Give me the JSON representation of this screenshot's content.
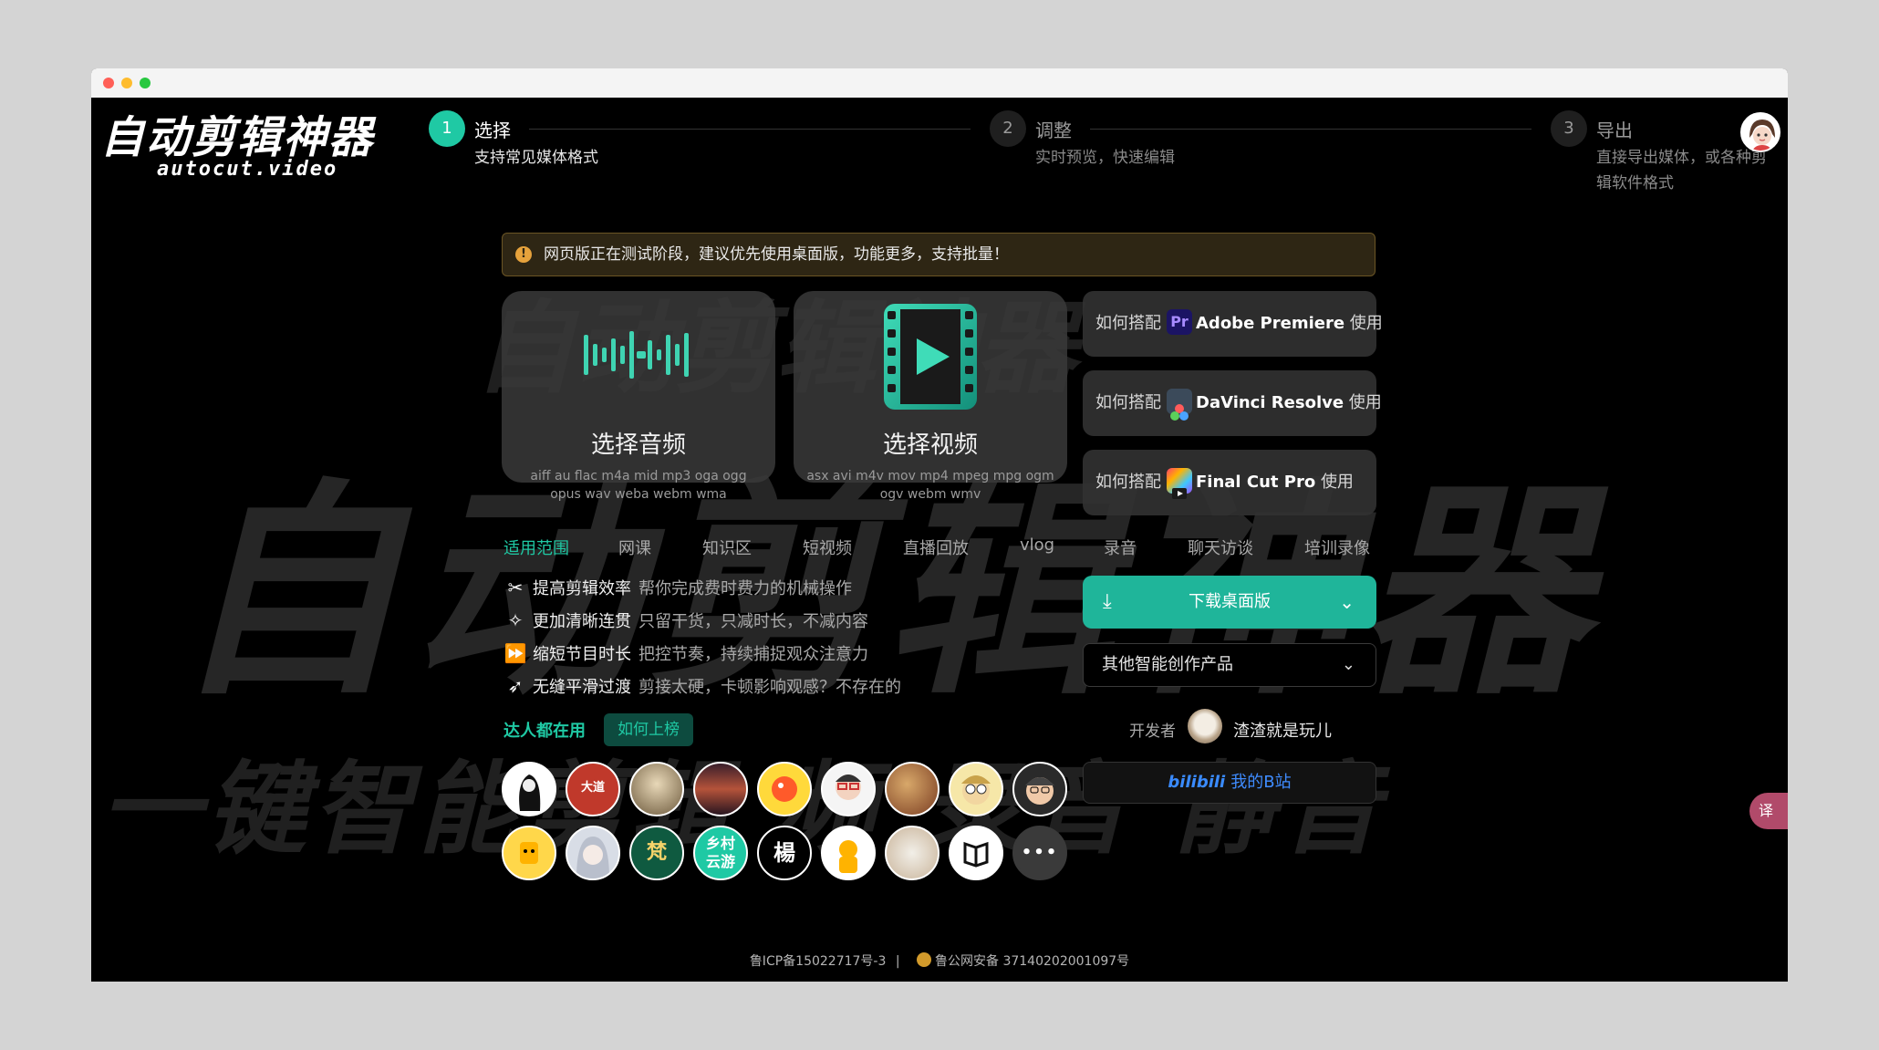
{
  "logo": {
    "title": "自动剪辑神器",
    "subtitle": "autocut.video"
  },
  "watermark": {
    "line1": "自动剪辑神器",
    "line2": "一键智能剪辑   频   录音   静音",
    "line3": "自动剪辑神器"
  },
  "steps": [
    {
      "num": "1",
      "title": "选择",
      "desc": "支持常见媒体格式"
    },
    {
      "num": "2",
      "title": "调整",
      "desc": "实时预览，快速编辑"
    },
    {
      "num": "3",
      "title": "导出",
      "desc1": "直接导出媒体，或各种剪",
      "desc2": "辑软件格式"
    }
  ],
  "notice": {
    "icon": "warning-icon",
    "text": "网页版正在测试阶段，建议优先使用桌面版，功能更多，支持批量！"
  },
  "cards": {
    "audio": {
      "title": "选择音频",
      "formats": "aiff au flac m4a mid mp3 oga ogg opus wav weba webm wma",
      "icon": "audio-wave-icon"
    },
    "video": {
      "title": "选择视频",
      "formats": "asx avi m4v mov mp4 mpeg mpg ogm ogv webm wmv",
      "icon": "film-play-icon"
    }
  },
  "integrations": [
    {
      "prefix": "如何搭配",
      "name": "Adobe Premiere",
      "suffix": "使用",
      "icon": "premiere-icon",
      "icon_text": "Pr"
    },
    {
      "prefix": "如何搭配",
      "name": "DaVinci Resolve",
      "suffix": "使用",
      "icon": "davinci-icon"
    },
    {
      "prefix": "如何搭配",
      "name": "Final Cut Pro",
      "suffix": "使用",
      "icon": "final-cut-icon"
    }
  ],
  "scope": {
    "label": "适用范围",
    "items": [
      "网课",
      "知识区",
      "短视频",
      "直播回放",
      "vlog",
      "录音",
      "聊天访谈",
      "培训录像"
    ]
  },
  "features": [
    {
      "icon": "scissors-icon",
      "title": "提高剪辑效率",
      "desc": "帮你完成费时费力的机械操作"
    },
    {
      "icon": "sparkle-icon",
      "title": "更加清晰连贯",
      "desc": "只留干货，只减时长，不减内容"
    },
    {
      "icon": "fast-forward-icon",
      "title": "缩短节目时长",
      "desc": "把控节奏，持续捕捉观众注意力"
    },
    {
      "icon": "rocket-icon",
      "title": "无缝平滑过渡",
      "desc": "剪接太硬，卡顿影响观感？不存在的"
    }
  ],
  "download": {
    "label": "下载桌面版"
  },
  "other_products": {
    "label": "其他智能创作产品"
  },
  "developer": {
    "label": "开发者",
    "name": "渣渣就是玩儿"
  },
  "bilibili": {
    "logo": "bilibili",
    "label": "我的B站"
  },
  "users": {
    "label": "达人都在用",
    "rank_button": "如何上榜",
    "avatar_texts": [
      "大道",
      "梵",
      "乡村\n云游",
      "楊"
    ],
    "more": "•••"
  },
  "footer": {
    "icp": "鲁ICP备15022717号-3",
    "sep": "|",
    "police": "鲁公网安备 37140202001097号"
  },
  "translate_tab": "译",
  "colors": {
    "accent": "#1fc9a4",
    "download": "#1fb59a",
    "notice_bg": "#2e2614",
    "bilibili": "#3a8bff"
  }
}
